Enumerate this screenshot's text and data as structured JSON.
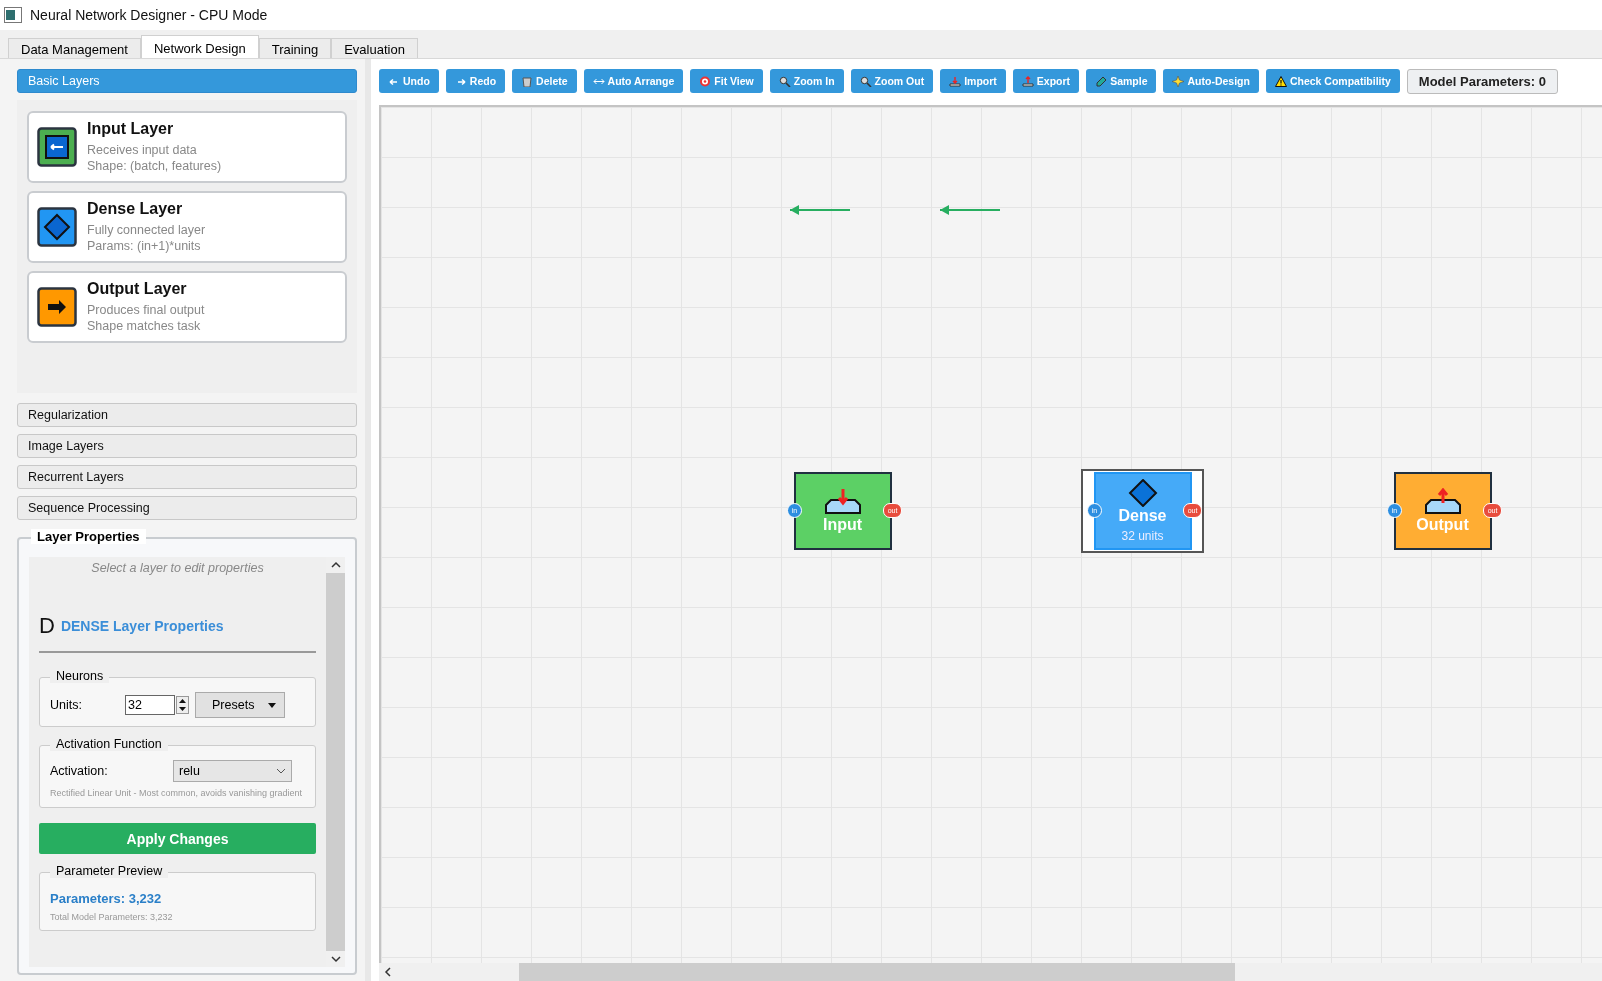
{
  "window": {
    "title": "Neural Network Designer - CPU Mode"
  },
  "tabs": [
    {
      "label": "Data Management",
      "selected": false
    },
    {
      "label": "Network Design",
      "selected": true
    },
    {
      "label": "Training",
      "selected": false
    },
    {
      "label": "Evaluation",
      "selected": false
    }
  ],
  "sidebar": {
    "sections": [
      {
        "label": "Basic Layers",
        "expanded": true,
        "items": [
          {
            "kind": "input",
            "name": "Input Layer",
            "description": "Receives input data",
            "detail": "Shape: (batch, features)"
          },
          {
            "kind": "dense",
            "name": "Dense Layer",
            "description": "Fully connected layer",
            "detail": "Params: (in+1)*units"
          },
          {
            "kind": "output",
            "name": "Output Layer",
            "description": "Produces final output",
            "detail": "Shape matches task"
          }
        ]
      },
      {
        "label": "Regularization",
        "expanded": false
      },
      {
        "label": "Image Layers",
        "expanded": false
      },
      {
        "label": "Recurrent Layers",
        "expanded": false
      },
      {
        "label": "Sequence Processing",
        "expanded": false
      }
    ]
  },
  "layer_properties": {
    "title": "Layer Properties",
    "hint": "Select a layer to edit properties",
    "glyph": "D",
    "heading": "DENSE Layer Properties",
    "neurons": {
      "title": "Neurons",
      "units_label": "Units:",
      "units_value": "32",
      "presets_label": "Presets"
    },
    "activation": {
      "title": "Activation Function",
      "label": "Activation:",
      "value": "relu",
      "description": "Rectified Linear Unit - Most common, avoids vanishing gradient"
    },
    "apply_button": "Apply Changes",
    "preview": {
      "title": "Parameter Preview",
      "parameters": "Parameters: 3,232",
      "total": "Total Model Parameters: 3,232"
    }
  },
  "toolbar": {
    "buttons": [
      {
        "kind": "undo",
        "label": "Undo"
      },
      {
        "kind": "redo",
        "label": "Redo"
      },
      {
        "kind": "delete",
        "label": "Delete"
      },
      {
        "kind": "arrange",
        "label": "Auto Arrange"
      },
      {
        "kind": "fit",
        "label": "Fit View"
      },
      {
        "kind": "zoom",
        "label": "Zoom In"
      },
      {
        "kind": "zoom",
        "label": "Zoom Out"
      },
      {
        "kind": "import",
        "label": "Import"
      },
      {
        "kind": "export",
        "label": "Export"
      },
      {
        "kind": "sample",
        "label": "Sample"
      },
      {
        "kind": "design",
        "label": "Auto-Design"
      },
      {
        "kind": "warning",
        "label": "Check Compatibility"
      }
    ],
    "model_parameters": "Model Parameters: 0"
  },
  "canvas": {
    "nodes": [
      {
        "kind": "input",
        "label": "Input",
        "in_port": "in",
        "out_port": "out",
        "selected": false
      },
      {
        "kind": "dense",
        "label": "Dense",
        "units": "32 units",
        "in_port": "in",
        "out_port": "out",
        "selected": true
      },
      {
        "kind": "output",
        "label": "Output",
        "in_port": "in",
        "out_port": "out",
        "selected": false
      }
    ]
  }
}
